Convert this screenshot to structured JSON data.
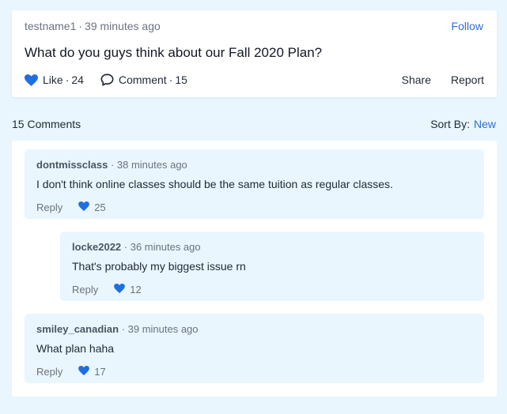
{
  "post": {
    "author": "testname1",
    "time": "39 minutes ago",
    "follow_label": "Follow",
    "title": "What do you guys think about our Fall 2020 Plan?",
    "like_label": "Like",
    "like_count": "24",
    "comment_label": "Comment",
    "comment_count": "15",
    "share_label": "Share",
    "report_label": "Report"
  },
  "comments_header": {
    "count_label": "15 Comments",
    "sort_label": "Sort By:",
    "sort_value": "New"
  },
  "comments": [
    {
      "author": "dontmissclass",
      "time": "38 minutes ago",
      "text": "I don't think online classes should be the same tuition as regular classes.",
      "reply_label": "Reply",
      "likes": "25"
    },
    {
      "author": "locke2022",
      "time": "36 minutes ago",
      "text": "That's probably my biggest issue rn",
      "reply_label": "Reply",
      "likes": "12"
    },
    {
      "author": "smiley_canadian",
      "time": "39 minutes ago",
      "text": "What plan haha",
      "reply_label": "Reply",
      "likes": "17"
    }
  ],
  "colors": {
    "accent": "#2f6fd6",
    "background": "#e9f6fd",
    "heart": "#1f6fe0"
  },
  "icons": {
    "like": "heart-icon",
    "comment": "speech-bubble-icon"
  }
}
